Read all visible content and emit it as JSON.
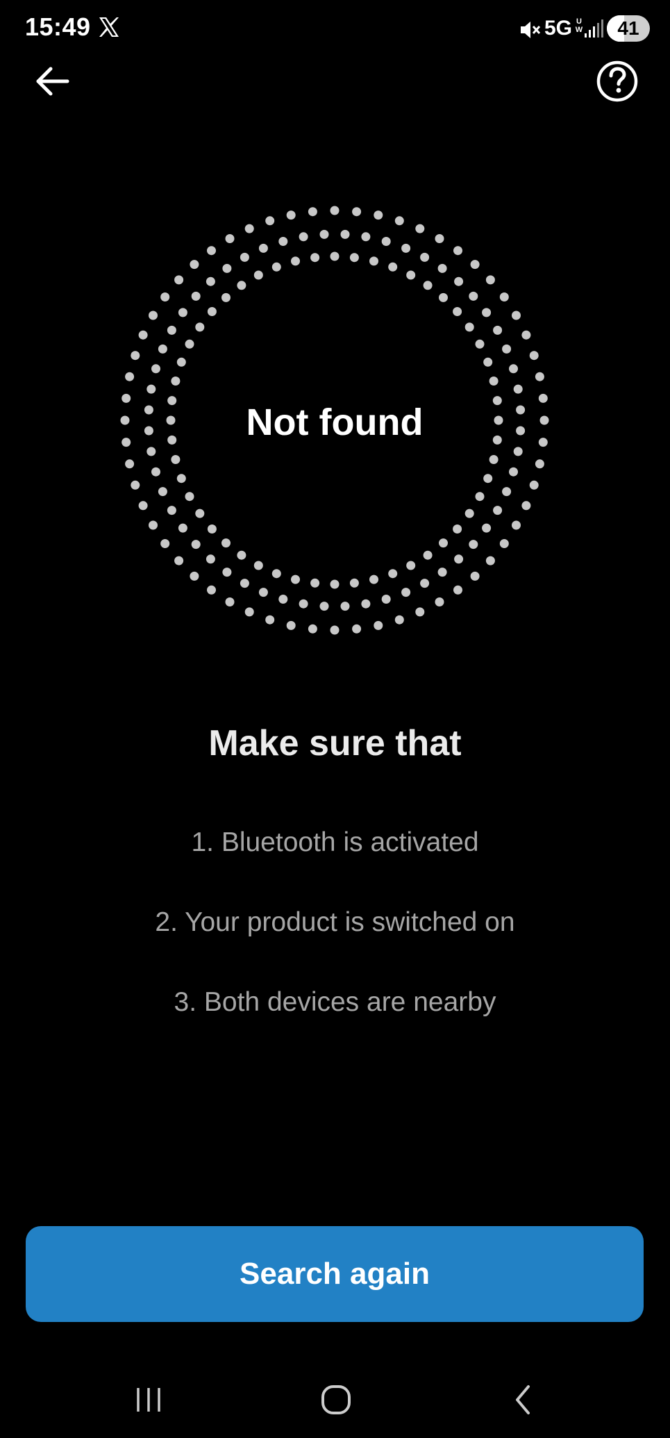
{
  "status_bar": {
    "time": "15:49",
    "network": "5G",
    "network_sub": "U W",
    "battery": "41",
    "battery_percent": 41
  },
  "header": {
    "back_icon": "arrow-left-icon",
    "help_icon": "question-circle-icon"
  },
  "scan": {
    "status_text": "Not found"
  },
  "checklist": {
    "heading": "Make sure that",
    "items": [
      "1. Bluetooth is activated",
      "2. Your product is switched on",
      "3. Both devices are nearby"
    ]
  },
  "actions": {
    "search_again_label": "Search again"
  },
  "colors": {
    "background": "#000000",
    "primary_button": "#2281c5",
    "secondary_text": "#a6a6a6",
    "dots": "#c8c8c8"
  },
  "nav_bar": {
    "recents_icon": "recents-icon",
    "home_icon": "home-icon",
    "back_icon": "back-chevron-icon"
  }
}
